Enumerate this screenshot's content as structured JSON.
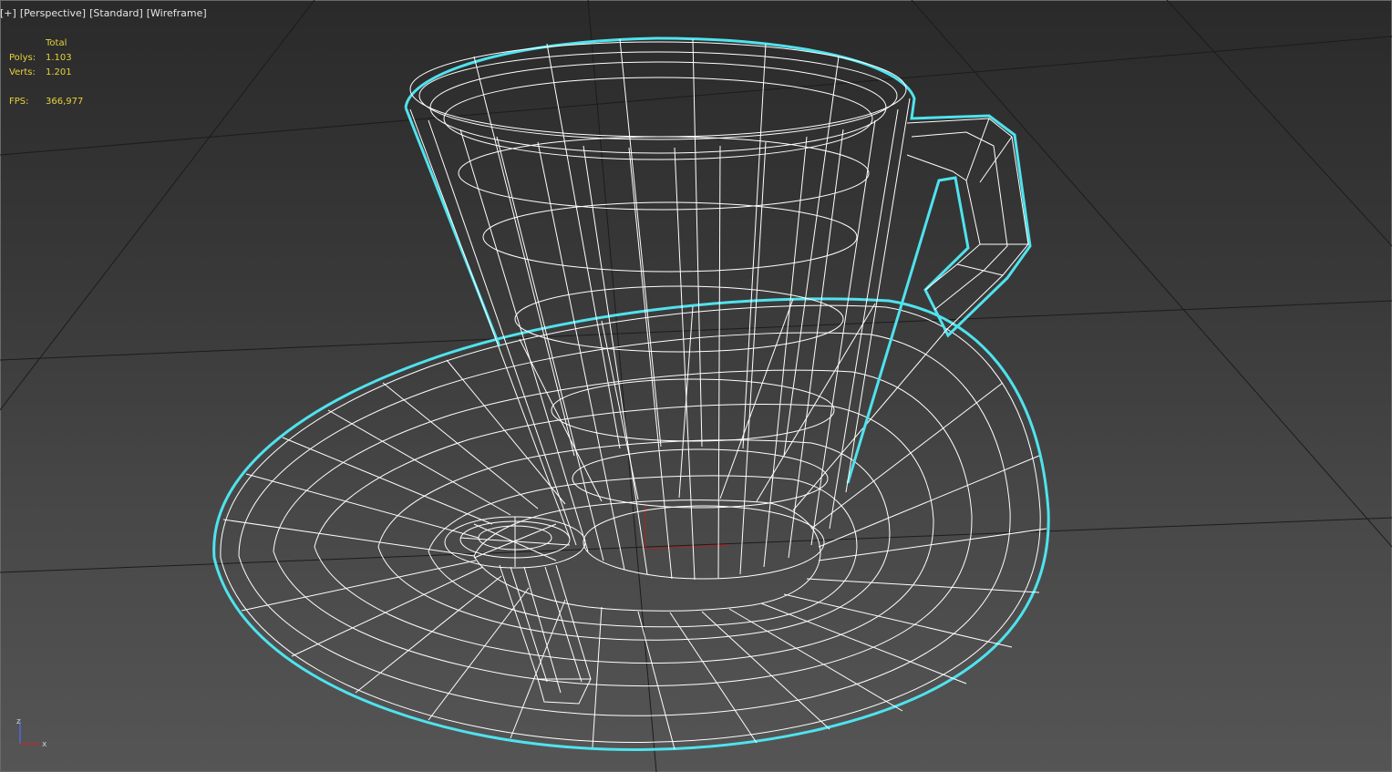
{
  "viewport": {
    "labels": [
      "[+]",
      "[Perspective]",
      "[Standard]",
      "[Wireframe]"
    ]
  },
  "stats": {
    "header": "Total",
    "polys_label": "Polys:",
    "polys_value": "1.103",
    "verts_label": "Verts:",
    "verts_value": "1.201",
    "fps_label": "FPS:",
    "fps_value": "366,977"
  },
  "gizmo": {
    "z_label": "z",
    "x_label": "x"
  },
  "colors": {
    "wire": "#ffffff",
    "selection": "#4fe3ee",
    "grid": "#1a1a1a",
    "stats": "#e8d23a",
    "x_axis": "#c82828",
    "z_axis": "#4a6cff"
  }
}
